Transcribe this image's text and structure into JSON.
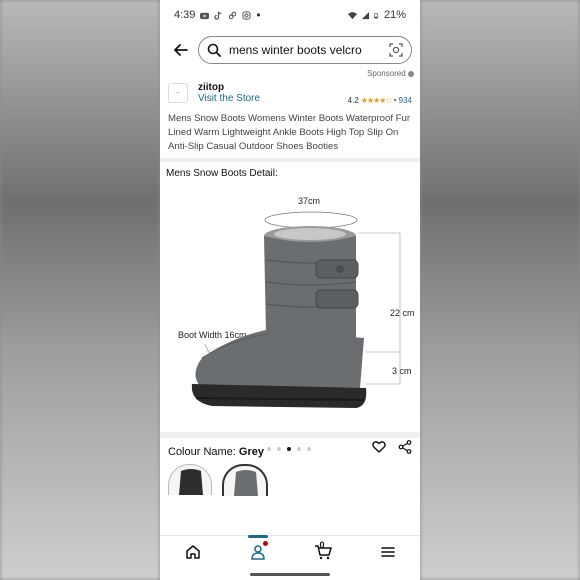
{
  "status_bar": {
    "time": "4:39",
    "battery": "21%",
    "icons": [
      "youtube-icon",
      "tiktok-icon",
      "link-icon",
      "instagram-icon",
      "dot-icon",
      "wifi-icon",
      "signal-icon",
      "battery-icon"
    ]
  },
  "search": {
    "query": "mens winter boots velcro",
    "icons": [
      "back-arrow-icon",
      "search-icon",
      "camera-scan-icon"
    ]
  },
  "sponsored": {
    "label": "Sponsored"
  },
  "store": {
    "name": "ziitop",
    "link_label": "Visit the Store",
    "rating": "4.2",
    "stars": "★★★★☆",
    "rating_value": 4.2,
    "review_count": "934"
  },
  "product": {
    "title": "Mens Snow Boots Womens Winter Boots Waterproof Fur Lined Warm Lightweight Ankle Boots High Top Slip On Anti-Slip Casual Outdoor Shoes Booties"
  },
  "detail_image": {
    "heading": "Mens Snow Boots Detail:",
    "circumference_label": "37cm",
    "boot_width_label": "Boot Width 16cm",
    "height_label": "22 cm",
    "heel_label": "3 cm",
    "dots_total": 5,
    "dots_active_index": 2,
    "colors": {
      "boot": "#6b6e70",
      "sole": "#2a2a2a",
      "fur": "#9a9a9a"
    }
  },
  "colour": {
    "label": "Colour Name:",
    "value": "Grey"
  },
  "bottom_nav": {
    "items": [
      "home-icon",
      "account-icon",
      "cart-icon",
      "menu-icon"
    ],
    "cart_count": "0",
    "active": "account-icon"
  },
  "colors": {
    "link": "#1a6b8f",
    "star": "#e49a1f",
    "badge": "#c40000"
  }
}
